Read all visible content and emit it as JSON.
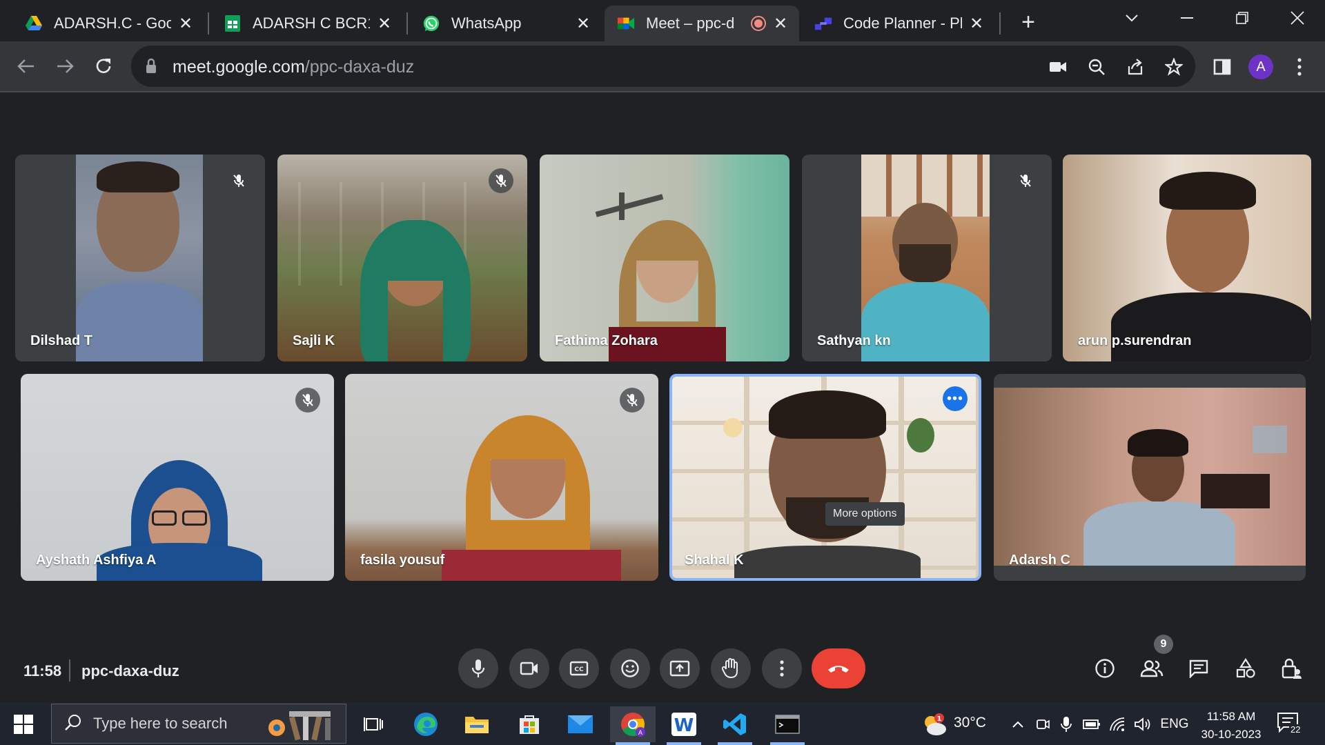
{
  "browser": {
    "tabs": [
      {
        "title": "ADARSH.C - Goog",
        "favicon": "google-drive-icon"
      },
      {
        "title": "ADARSH C BCR12",
        "favicon": "google-sheets-icon"
      },
      {
        "title": "WhatsApp",
        "favicon": "whatsapp-icon"
      },
      {
        "title": "Meet – ppc-d",
        "favicon": "google-meet-icon",
        "recording": true,
        "active": true
      },
      {
        "title": "Code Planner - Pl",
        "favicon": "code-planner-icon"
      }
    ],
    "url_host": "meet.google.com",
    "url_path": "/ppc-daxa-duz",
    "profile_initial": "A"
  },
  "meet": {
    "participants": [
      {
        "name": "Dilshad T",
        "muted": true
      },
      {
        "name": "Sajli K",
        "muted": true
      },
      {
        "name": "Fathima Zohara",
        "muted": false
      },
      {
        "name": "Sathyan kn",
        "muted": true
      },
      {
        "name": "arun p.surendran",
        "muted": false
      },
      {
        "name": "Ayshath Ashfiya A",
        "muted": true
      },
      {
        "name": "fasila yousuf",
        "muted": true
      },
      {
        "name": "Shahal K",
        "muted": false,
        "focused": true
      },
      {
        "name": "Adarsh C",
        "muted": false
      }
    ],
    "tooltip": "More options",
    "time": "11:58",
    "meeting_code": "ppc-daxa-duz",
    "participant_count": "9",
    "colors": {
      "end_call": "#ea4335",
      "focus_border": "#8ab4f8",
      "more_button": "#1a73e8"
    }
  },
  "taskbar": {
    "search_placeholder": "Type here to search",
    "weather_temp": "30°C",
    "weather_badge": "1",
    "language": "ENG",
    "clock_time": "11:58 AM",
    "clock_date": "30-10-2023",
    "notification_count": "22"
  }
}
